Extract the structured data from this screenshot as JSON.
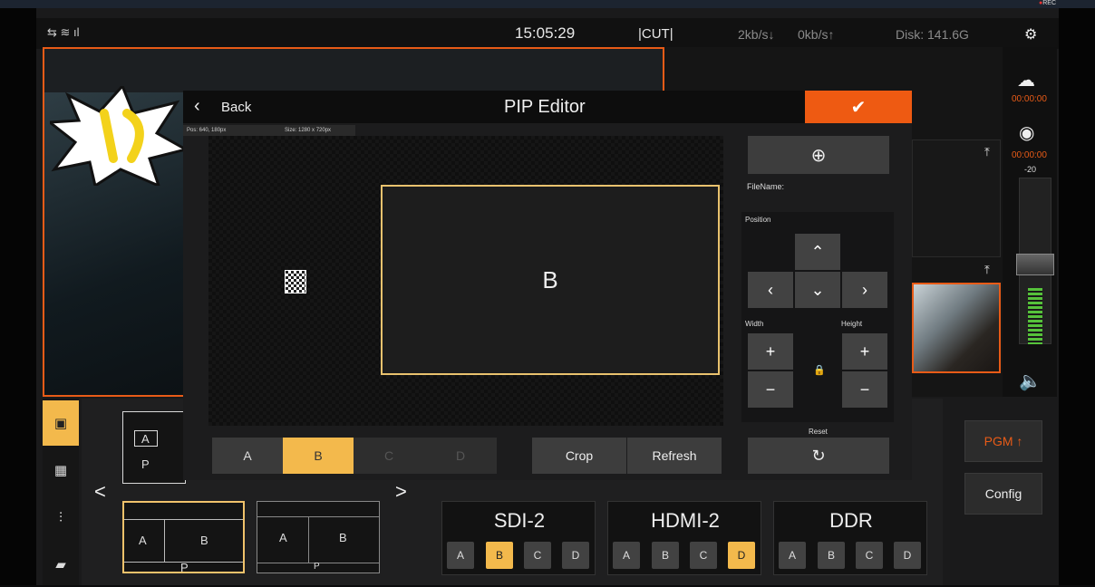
{
  "topbar": {
    "time": "15:05:29",
    "mode": "|CUT|",
    "down": "2kb/s↓",
    "up": "0kb/s↑",
    "disk": "Disk: 141.6G",
    "os_rec": "REC"
  },
  "right": {
    "time1": "00:00:00",
    "time2": "00:00:00",
    "db": "-20",
    "pgm": "PGM ↑",
    "config": "Config"
  },
  "bottom": {
    "nav_prev": "<",
    "nav_next": ">",
    "card1": {
      "a": "A",
      "p": "P"
    },
    "card2": {
      "a": "A",
      "b": "B",
      "p": "P"
    },
    "card3": {
      "a": "A",
      "b": "B",
      "p": "P"
    },
    "groups": [
      {
        "title": "SDI-2",
        "selected": "B"
      },
      {
        "title": "HDMI-2",
        "selected": "D"
      },
      {
        "title": "DDR",
        "selected": ""
      }
    ],
    "letters": [
      "A",
      "B",
      "C",
      "D"
    ]
  },
  "modal": {
    "back": "Back",
    "title": "PIP Editor",
    "confirm": "✔",
    "pos_info": "Pos: 640, 180px",
    "size_info": "Size: 1280 x 720px",
    "pip_label": "B",
    "segments": [
      {
        "label": "A",
        "state": "normal"
      },
      {
        "label": "B",
        "state": "on"
      },
      {
        "label": "C",
        "state": "dis"
      },
      {
        "label": "D",
        "state": "dis"
      }
    ],
    "crop": "Crop",
    "refresh": "Refresh",
    "filename": "FileName:",
    "position": "Position",
    "width": "Width",
    "height": "Height",
    "reset": "Reset"
  },
  "colors": {
    "accent": "#e85b17",
    "highlight": "#f3b94c",
    "pip_border": "#e9c26e"
  }
}
